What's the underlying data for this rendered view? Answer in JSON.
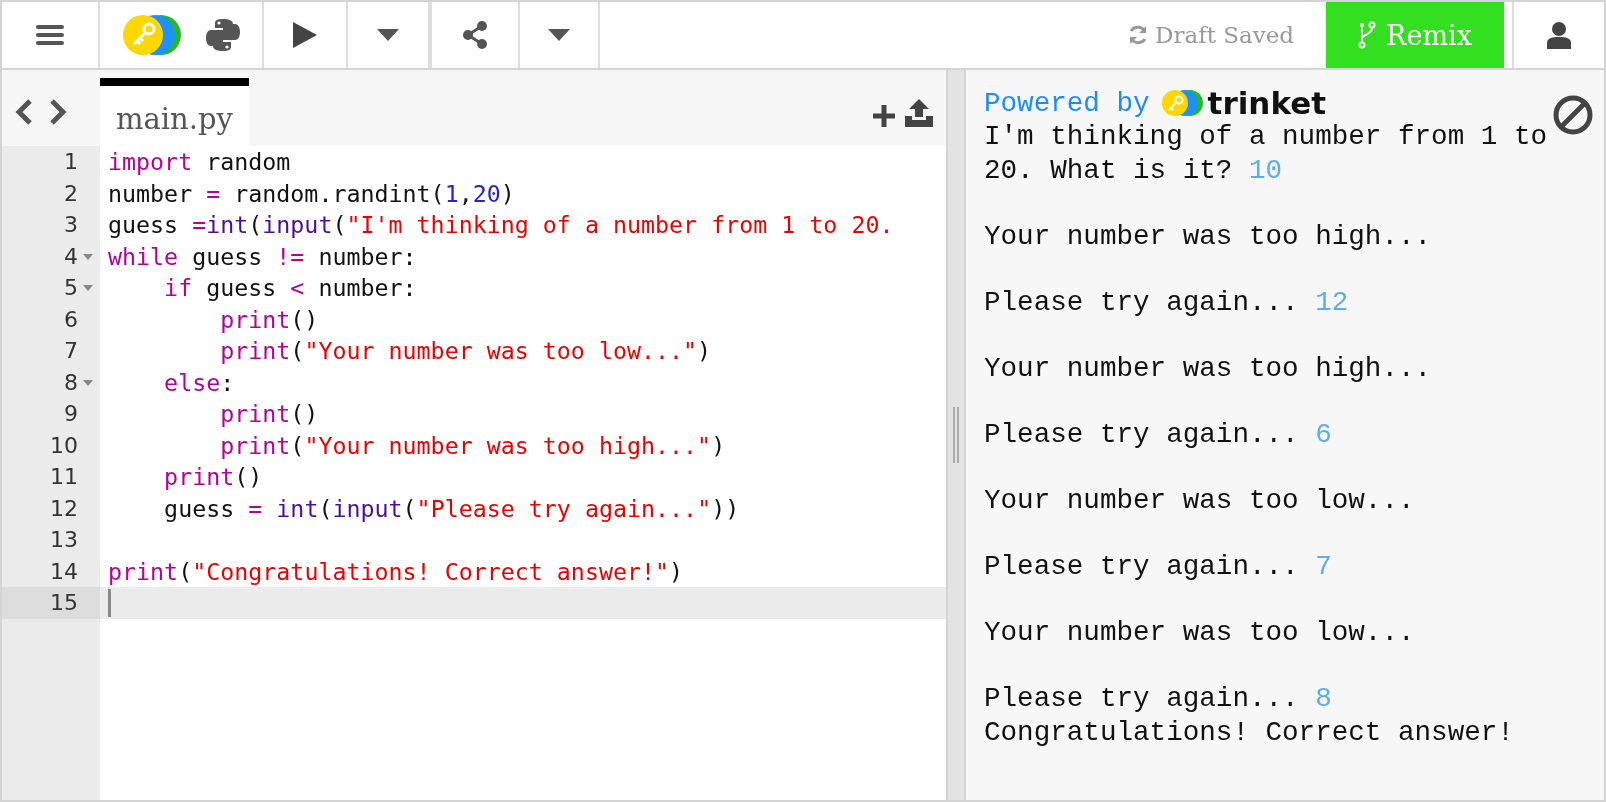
{
  "toolbar": {
    "draft_status": "Draft Saved",
    "remix_label": "Remix"
  },
  "tabs": [
    {
      "label": "main.py",
      "selected": true
    }
  ],
  "code_lines": [
    {
      "number": "1",
      "foldable": false,
      "active": false,
      "tokens": [
        {
          "text": "import",
          "kind": "keyword"
        },
        {
          "text": " random",
          "kind": "plain"
        }
      ]
    },
    {
      "number": "2",
      "foldable": false,
      "active": false,
      "tokens": [
        {
          "text": "number ",
          "kind": "plain"
        },
        {
          "text": "=",
          "kind": "operator"
        },
        {
          "text": " random.randint(",
          "kind": "plain"
        },
        {
          "text": "1",
          "kind": "number"
        },
        {
          "text": ",",
          "kind": "plain"
        },
        {
          "text": "20",
          "kind": "number"
        },
        {
          "text": ")",
          "kind": "plain"
        }
      ]
    },
    {
      "number": "3",
      "foldable": false,
      "active": false,
      "tokens": [
        {
          "text": "guess ",
          "kind": "plain"
        },
        {
          "text": "=",
          "kind": "operator"
        },
        {
          "text": "int",
          "kind": "builtin"
        },
        {
          "text": "(",
          "kind": "plain"
        },
        {
          "text": "input",
          "kind": "builtin"
        },
        {
          "text": "(",
          "kind": "plain"
        },
        {
          "text": "\"I'm thinking of a number from 1 to 20.",
          "kind": "string"
        }
      ]
    },
    {
      "number": "4",
      "foldable": true,
      "active": false,
      "tokens": [
        {
          "text": "while",
          "kind": "keyword"
        },
        {
          "text": " guess ",
          "kind": "plain"
        },
        {
          "text": "!=",
          "kind": "operator"
        },
        {
          "text": " number:",
          "kind": "plain"
        }
      ]
    },
    {
      "number": "5",
      "foldable": true,
      "active": false,
      "tokens": [
        {
          "text": "    if",
          "kind": "keyword"
        },
        {
          "text": " guess ",
          "kind": "plain"
        },
        {
          "text": "<",
          "kind": "operator"
        },
        {
          "text": " number:",
          "kind": "plain"
        }
      ]
    },
    {
      "number": "6",
      "foldable": false,
      "active": false,
      "tokens": [
        {
          "text": "        print",
          "kind": "keyword"
        },
        {
          "text": "()",
          "kind": "plain"
        }
      ]
    },
    {
      "number": "7",
      "foldable": false,
      "active": false,
      "tokens": [
        {
          "text": "        print",
          "kind": "keyword"
        },
        {
          "text": "(",
          "kind": "plain"
        },
        {
          "text": "\"Your number was too low...\"",
          "kind": "string"
        },
        {
          "text": ")",
          "kind": "plain"
        }
      ]
    },
    {
      "number": "8",
      "foldable": true,
      "active": false,
      "tokens": [
        {
          "text": "    else",
          "kind": "keyword"
        },
        {
          "text": ":",
          "kind": "plain"
        }
      ]
    },
    {
      "number": "9",
      "foldable": false,
      "active": false,
      "tokens": [
        {
          "text": "        print",
          "kind": "keyword"
        },
        {
          "text": "()",
          "kind": "plain"
        }
      ]
    },
    {
      "number": "10",
      "foldable": false,
      "active": false,
      "tokens": [
        {
          "text": "        print",
          "kind": "keyword"
        },
        {
          "text": "(",
          "kind": "plain"
        },
        {
          "text": "\"Your number was too high...\"",
          "kind": "string"
        },
        {
          "text": ")",
          "kind": "plain"
        }
      ]
    },
    {
      "number": "11",
      "foldable": false,
      "active": false,
      "tokens": [
        {
          "text": "    print",
          "kind": "keyword"
        },
        {
          "text": "()",
          "kind": "plain"
        }
      ]
    },
    {
      "number": "12",
      "foldable": false,
      "active": false,
      "tokens": [
        {
          "text": "    guess ",
          "kind": "plain"
        },
        {
          "text": "= ",
          "kind": "operator"
        },
        {
          "text": "int",
          "kind": "builtin"
        },
        {
          "text": "(",
          "kind": "plain"
        },
        {
          "text": "input",
          "kind": "builtin"
        },
        {
          "text": "(",
          "kind": "plain"
        },
        {
          "text": "\"Please try again...\"",
          "kind": "string"
        },
        {
          "text": "))",
          "kind": "plain"
        }
      ]
    },
    {
      "number": "13",
      "foldable": false,
      "active": false
    },
    {
      "number": "14",
      "foldable": false,
      "active": false,
      "tokens": [
        {
          "text": "print",
          "kind": "keyword"
        },
        {
          "text": "(",
          "kind": "plain"
        },
        {
          "text": "\"Congratulations! Correct answer!\"",
          "kind": "string"
        },
        {
          "text": ")",
          "kind": "plain"
        }
      ]
    },
    {
      "number": "15",
      "foldable": false,
      "active": true
    }
  ],
  "console": {
    "powered_by": "Powered by",
    "brand": "trinket",
    "lines": [
      {
        "gap_before": false,
        "text": "I'm thinking of a number from 1 to 20. What is it?",
        "input": "10"
      },
      {
        "gap_before": true,
        "text": "Your number was too high..."
      },
      {
        "gap_before": true,
        "text": "Please try again...",
        "input": "12"
      },
      {
        "gap_before": true,
        "text": "Your number was too high..."
      },
      {
        "gap_before": true,
        "text": "Please try again...",
        "input": "6"
      },
      {
        "gap_before": true,
        "text": "Your number was too low..."
      },
      {
        "gap_before": true,
        "text": "Please try again...",
        "input": "7"
      },
      {
        "gap_before": true,
        "text": "Your number was too low..."
      },
      {
        "gap_before": true,
        "text": "Please try again...",
        "input": "8"
      },
      {
        "gap_before": false,
        "text": "Congratulations! Correct answer!"
      }
    ]
  }
}
